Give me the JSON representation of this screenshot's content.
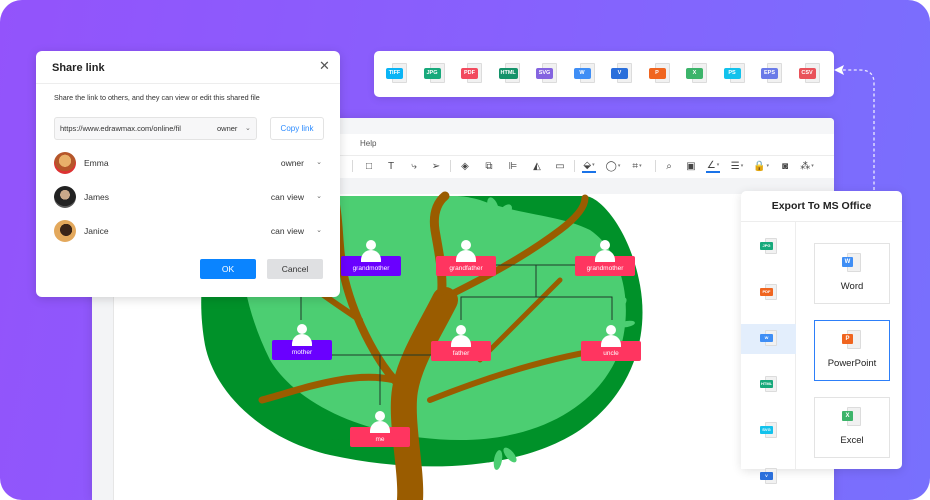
{
  "colors": {
    "background_start": "#9353fb",
    "background_end": "#7870fd",
    "primary_button": "#0a84ff",
    "link": "#2d8cff",
    "node_pink": "#ff3560",
    "node_purple": "#6a00ff",
    "tree_dark_green": "#009129",
    "tree_light_green": "#4cce72",
    "trunk_brown": "#9a5c00"
  },
  "editor": {
    "menu": {
      "help_label": "Help"
    },
    "toolbar": [
      {
        "icon": "rectangle-icon",
        "glyph": "□"
      },
      {
        "icon": "text-icon",
        "glyph": "T"
      },
      {
        "icon": "connector-icon",
        "glyph": "⤷"
      },
      {
        "icon": "pointer-icon",
        "glyph": "➢"
      },
      {
        "icon": "layers-icon",
        "glyph": "◈"
      },
      {
        "icon": "group-icon",
        "glyph": "⧉"
      },
      {
        "icon": "align-icon",
        "glyph": "⊫"
      },
      {
        "icon": "flip-icon",
        "glyph": "◭"
      },
      {
        "icon": "frame-icon",
        "glyph": "▭"
      },
      {
        "icon": "fill-color-icon",
        "glyph": "⬙"
      },
      {
        "icon": "shape-style-icon",
        "glyph": "◯"
      },
      {
        "icon": "crop-icon",
        "glyph": "⌗"
      },
      {
        "icon": "search-icon",
        "glyph": "⌕"
      },
      {
        "icon": "preview-icon",
        "glyph": "▣"
      },
      {
        "icon": "line-color-icon",
        "glyph": "∠"
      },
      {
        "icon": "line-style-icon",
        "glyph": "☰"
      },
      {
        "icon": "lock-icon",
        "glyph": "🔒"
      },
      {
        "icon": "fit-icon",
        "glyph": "◙"
      },
      {
        "icon": "more-icon",
        "glyph": "⁂"
      }
    ]
  },
  "family_tree": {
    "nodes": [
      {
        "id": "grandmother1",
        "label": "grandmother",
        "color": "purple"
      },
      {
        "id": "grandfather",
        "label": "grandfather",
        "color": "pink"
      },
      {
        "id": "grandmother2",
        "label": "grandmother",
        "color": "pink"
      },
      {
        "id": "mother",
        "label": "mother",
        "color": "purple"
      },
      {
        "id": "father",
        "label": "father",
        "color": "pink"
      },
      {
        "id": "uncle",
        "label": "uncle",
        "color": "pink"
      },
      {
        "id": "me",
        "label": "me",
        "color": "pink"
      }
    ]
  },
  "share_dialog": {
    "title": "Share link",
    "description": "Share the link to others, and they can view or edit this shared file",
    "link_url": "https://www.edrawmax.com/online/fil",
    "link_permission": "owner",
    "copy_label": "Copy link",
    "members": [
      {
        "name": "Emma",
        "role": "owner"
      },
      {
        "name": "James",
        "role": "can view"
      },
      {
        "name": "Janice",
        "role": "can view"
      }
    ],
    "ok_label": "OK",
    "cancel_label": "Cancel"
  },
  "formats_bar": [
    {
      "label": "TIFF",
      "color": "#0ab4f5"
    },
    {
      "label": "JPG",
      "color": "#17a97b"
    },
    {
      "label": "PDF",
      "color": "#f24a5e"
    },
    {
      "label": "HTML",
      "color": "#14936a"
    },
    {
      "label": "SVG",
      "color": "#8464e0"
    },
    {
      "label": "W",
      "color": "#3f8ef5"
    },
    {
      "label": "V",
      "color": "#2a6fdb"
    },
    {
      "label": "P",
      "color": "#f0651f"
    },
    {
      "label": "X",
      "color": "#3cb46a"
    },
    {
      "label": "PS",
      "color": "#13c2ec"
    },
    {
      "label": "EPS",
      "color": "#6a7be8"
    },
    {
      "label": "CSV",
      "color": "#e9525a"
    }
  ],
  "export_panel": {
    "title": "Export To MS Office",
    "side_formats": [
      {
        "label": "JPG",
        "color": "#17a97b",
        "active": false
      },
      {
        "label": "PDF",
        "color": "#f0651f",
        "active": false
      },
      {
        "label": "W",
        "color": "#3f8ef5",
        "active": true
      },
      {
        "label": "HTML",
        "color": "#17a97b",
        "active": false
      },
      {
        "label": "SVG",
        "color": "#13c2ec",
        "active": false
      },
      {
        "label": "V",
        "color": "#2a6fdb",
        "active": false
      }
    ],
    "options": [
      {
        "label": "Word",
        "badge": "W",
        "color": "#3f8ef5",
        "selected": false
      },
      {
        "label": "PowerPoint",
        "badge": "P",
        "color": "#f0651f",
        "selected": true
      },
      {
        "label": "Excel",
        "badge": "X",
        "color": "#3cb46a",
        "selected": false
      }
    ]
  }
}
